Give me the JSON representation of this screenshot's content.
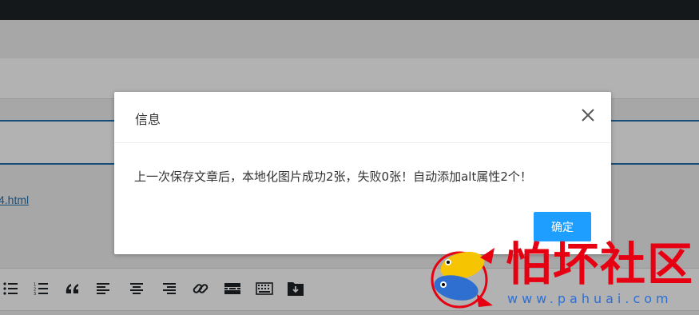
{
  "editor": {
    "link_text": "4.html"
  },
  "toolbar": {
    "buttons": [
      "bullet-list",
      "numbered-list",
      "blockquote",
      "align-left",
      "align-center",
      "align-right",
      "insert-link",
      "read-more",
      "toolbar-toggle",
      "download"
    ]
  },
  "dialog": {
    "title": "信息",
    "message": "上一次保存文章后，本地化图片成功2张，失败0张！自动添加alt属性2个！",
    "confirm_label": "确定",
    "close_icon": "close-icon"
  },
  "watermark": {
    "text": "怕坏社区",
    "url": "www.pahuai.com"
  },
  "colors": {
    "topbar": "#1d2327",
    "accent_blue": "#2271b1",
    "confirm_button": "#1e9fff",
    "watermark_red": "#e60012",
    "watermark_blue": "#2f6fd0"
  }
}
